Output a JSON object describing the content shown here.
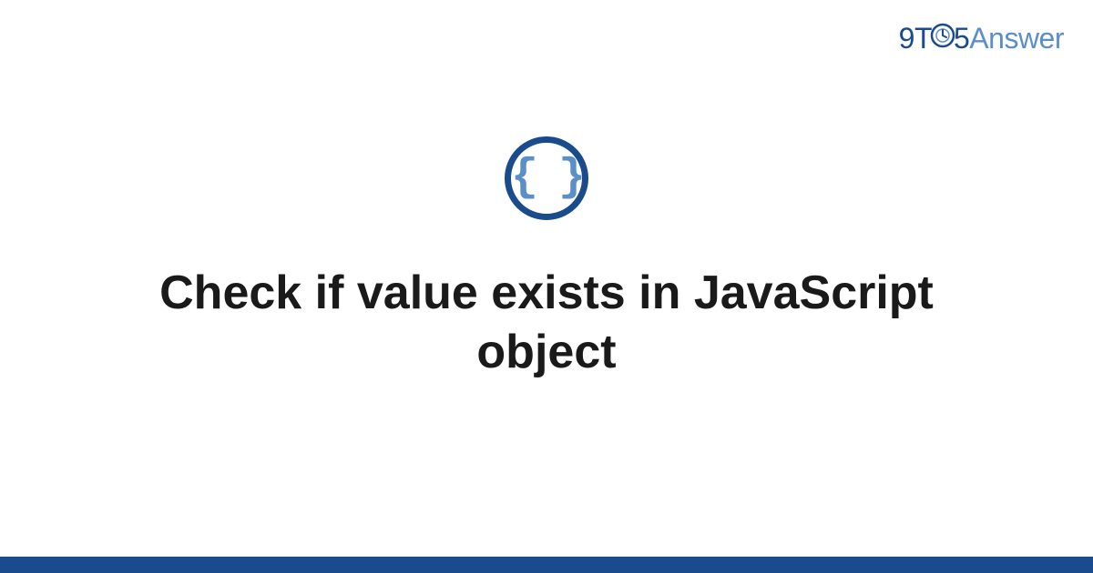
{
  "logo": {
    "part1": "9T",
    "part2": "5",
    "part3": "Answer"
  },
  "icon": {
    "braces": "{ }",
    "name": "code-braces"
  },
  "title": "Check if value exists in JavaScript object",
  "colors": {
    "primary": "#1a4b8c",
    "secondary": "#5b8fc7",
    "text": "#1a1a1a"
  }
}
